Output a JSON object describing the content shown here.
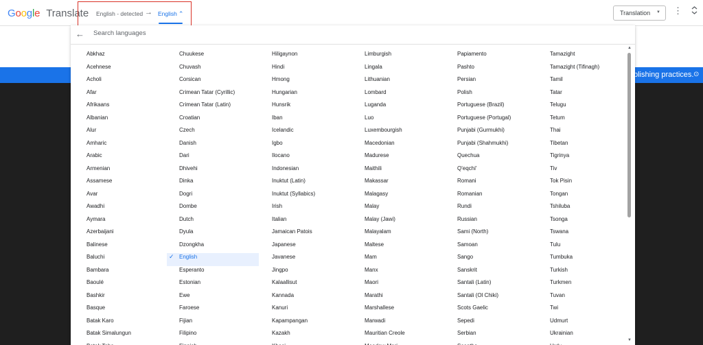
{
  "app": {
    "logo_google": "Google",
    "logo_word": "Translate"
  },
  "lang_pair": {
    "source": "English - detected",
    "arrow": "→",
    "target": "English",
    "target_chevron": "⌃"
  },
  "mode": {
    "label": "Translation",
    "dropdown": "▼"
  },
  "menu_icon": "⋮",
  "collapse_icon": "⌃⌄",
  "banner": {
    "text": "blishing practices.",
    "icon": "⊙"
  },
  "search": {
    "back_icon": "←",
    "placeholder": "Search languages"
  },
  "selected_check": "✓",
  "scroll": {
    "up": "▲",
    "down": "▼"
  },
  "columns": [
    [
      "Abkhaz",
      "Acehnese",
      "Acholi",
      "Afar",
      "Afrikaans",
      "Albanian",
      "Alur",
      "Amharic",
      "Arabic",
      "Armenian",
      "Assamese",
      "Avar",
      "Awadhi",
      "Aymara",
      "Azerbaijani",
      "Balinese",
      "Baluchi",
      "Bambara",
      "Baoulé",
      "Bashkir",
      "Basque",
      "Batak Karo",
      "Batak Simalungun",
      "Batak Toba"
    ],
    [
      "Chuukese",
      "Chuvash",
      "Corsican",
      "Crimean Tatar (Cyrillic)",
      "Crimean Tatar (Latin)",
      "Croatian",
      "Czech",
      "Danish",
      "Dari",
      "Dhivehi",
      "Dinka",
      "Dogri",
      "Dombe",
      "Dutch",
      "Dyula",
      "Dzongkha",
      "English",
      "Esperanto",
      "Estonian",
      "Ewe",
      "Faroese",
      "Fijian",
      "Filipino",
      "Finnish"
    ],
    [
      "Hiligaynon",
      "Hindi",
      "Hmong",
      "Hungarian",
      "Hunsrik",
      "Iban",
      "Icelandic",
      "Igbo",
      "Ilocano",
      "Indonesian",
      "Inuktut (Latin)",
      "Inuktut (Syllabics)",
      "Irish",
      "Italian",
      "Jamaican Patois",
      "Japanese",
      "Javanese",
      "Jingpo",
      "Kalaallisut",
      "Kannada",
      "Kanuri",
      "Kapampangan",
      "Kazakh",
      "Khasi"
    ],
    [
      "Limburgish",
      "Lingala",
      "Lithuanian",
      "Lombard",
      "Luganda",
      "Luo",
      "Luxembourgish",
      "Macedonian",
      "Madurese",
      "Maithili",
      "Makassar",
      "Malagasy",
      "Malay",
      "Malay (Jawi)",
      "Malayalam",
      "Maltese",
      "Mam",
      "Manx",
      "Maori",
      "Marathi",
      "Marshallese",
      "Marwadi",
      "Mauritian Creole",
      "Meadow Mari"
    ],
    [
      "Papiamento",
      "Pashto",
      "Persian",
      "Polish",
      "Portuguese (Brazil)",
      "Portuguese (Portugal)",
      "Punjabi (Gurmukhi)",
      "Punjabi (Shahmukhi)",
      "Quechua",
      "Q'eqchi'",
      "Romani",
      "Romanian",
      "Rundi",
      "Russian",
      "Sami (North)",
      "Samoan",
      "Sango",
      "Sanskrit",
      "Santali (Latin)",
      "Santali (Ol Chiki)",
      "Scots Gaelic",
      "Sepedi",
      "Serbian",
      "Sesotho"
    ],
    [
      "Tamazight",
      "Tamazight (Tifinagh)",
      "Tamil",
      "Tatar",
      "Telugu",
      "Tetum",
      "Thai",
      "Tibetan",
      "Tigrinya",
      "Tiv",
      "Tok Pisin",
      "Tongan",
      "Tshiluba",
      "Tsonga",
      "Tswana",
      "Tulu",
      "Tumbuka",
      "Turkish",
      "Turkmen",
      "Tuvan",
      "Twi",
      "Udmurt",
      "Ukrainian",
      "Urdu"
    ]
  ],
  "selected_language": "English",
  "colors": {
    "accent": "#1a73e8",
    "highlight": "#e8f0fe",
    "outline": "#d93025",
    "dark_bg": "#1f1f1f"
  }
}
